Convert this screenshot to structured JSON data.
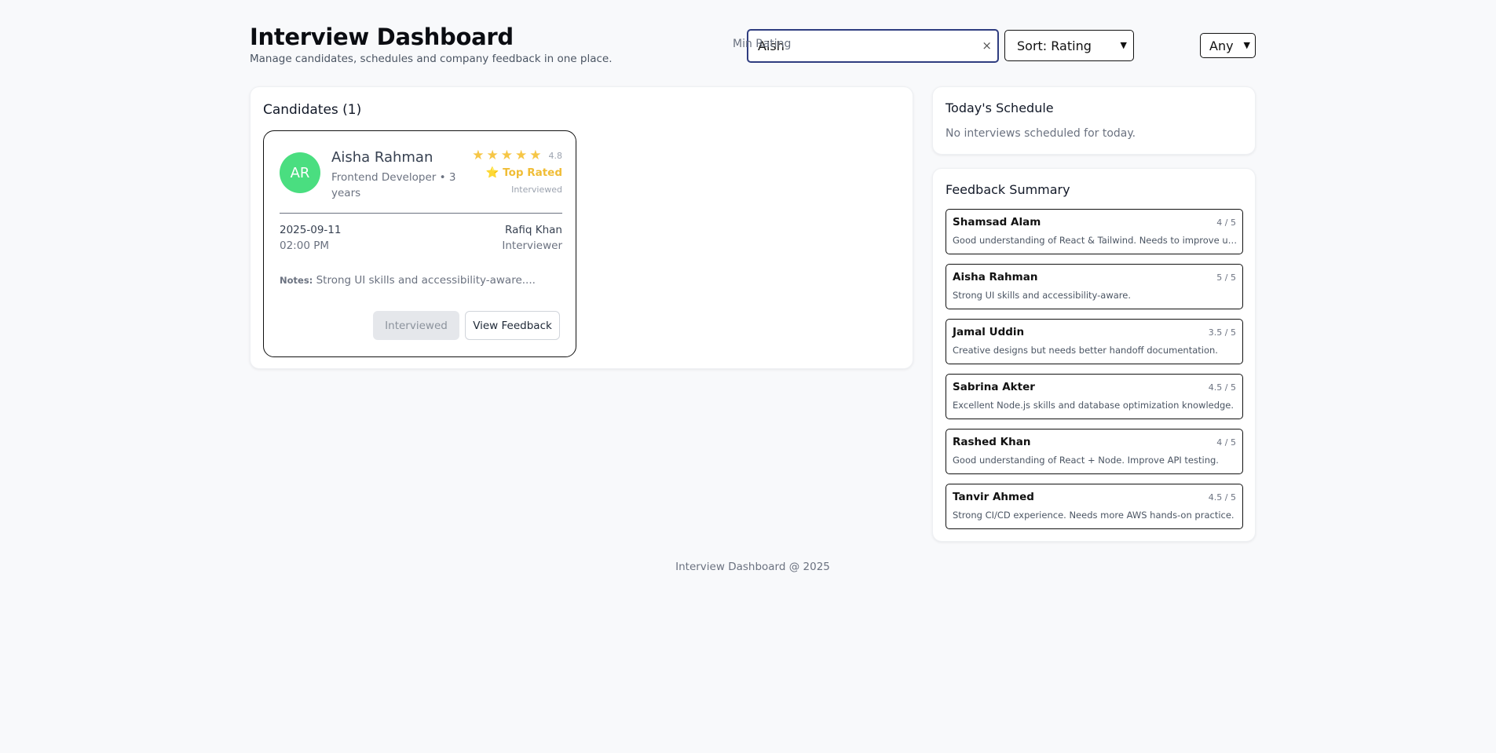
{
  "header": {
    "title": "Interview Dashboard",
    "subtitle": "Manage candidates, schedules and company feedback in one place."
  },
  "controls": {
    "search_value": "Aish",
    "clear_icon": "close-icon",
    "clear_glyph": "×",
    "sort_label": "Sort: Rating",
    "min_rating_label": "Min Rating",
    "min_rating_value": "Any"
  },
  "candidates": {
    "title": "Candidates (1)",
    "items": [
      {
        "initials": "AR",
        "avatar_color": "#4ade80",
        "name": "Aisha Rahman",
        "role": "Frontend Developer • 3 years",
        "stars": 5,
        "rating": "4.8",
        "badge": "⭐ Top Rated",
        "status": "Interviewed",
        "date": "2025-09-11",
        "time": "02:00 PM",
        "interviewer": "Rafiq Khan",
        "interviewer_label": "Interviewer",
        "notes_label": "Notes:",
        "notes": "Strong UI skills and accessibility-aware....",
        "status_button": "Interviewed",
        "feedback_button": "View Feedback"
      }
    ]
  },
  "schedule": {
    "title": "Today's Schedule",
    "empty_text": "No interviews scheduled for today."
  },
  "feedback": {
    "title": "Feedback Summary",
    "items": [
      {
        "name": "Shamsad Alam",
        "score": "4 / 5",
        "text": "Good understanding of React & Tailwind. Needs to improve unit testing."
      },
      {
        "name": "Aisha Rahman",
        "score": "5 / 5",
        "text": "Strong UI skills and accessibility-aware."
      },
      {
        "name": "Jamal Uddin",
        "score": "3.5 / 5",
        "text": "Creative designs but needs better handoff documentation."
      },
      {
        "name": "Sabrina Akter",
        "score": "4.5 / 5",
        "text": "Excellent Node.js skills and database optimization knowledge."
      },
      {
        "name": "Rashed Khan",
        "score": "4 / 5",
        "text": "Good understanding of React + Node. Improve API testing."
      },
      {
        "name": "Tanvir Ahmed",
        "score": "4.5 / 5",
        "text": "Strong CI/CD experience. Needs more AWS hands-on practice."
      }
    ]
  },
  "footer": {
    "text": "Interview Dashboard @ 2025"
  },
  "colors": {
    "accent_border": "#2f3d80",
    "star": "#f6c646",
    "top_rated": "#f0bd36",
    "avatar": "#4ade80"
  }
}
